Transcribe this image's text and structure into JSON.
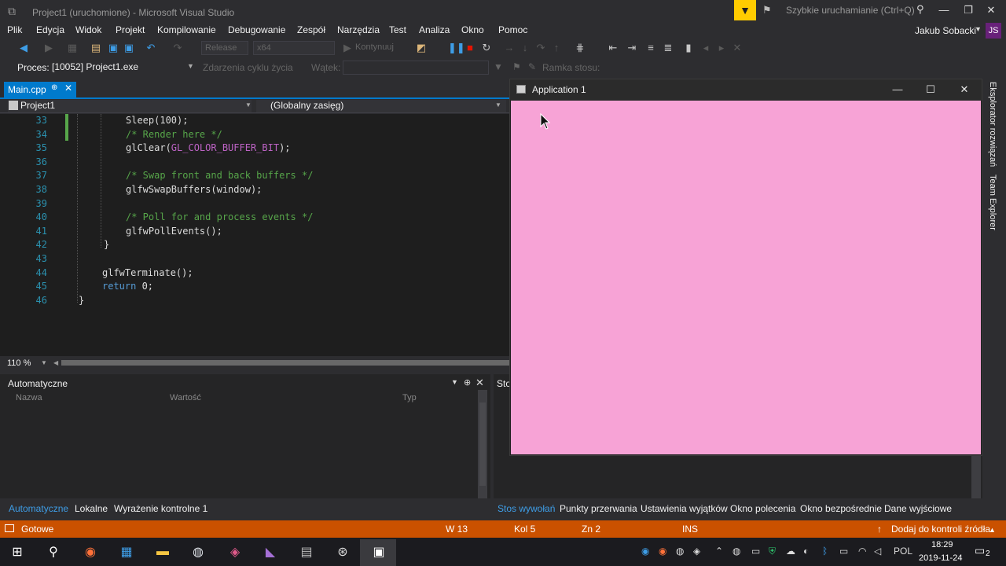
{
  "window": {
    "title": "Project1 (uruchomione) - Microsoft Visual Studio",
    "quick_launch_placeholder": "Szybkie uruchamianie (Ctrl+Q)",
    "user_name": "Jakub Sobacki",
    "user_initials": "JS"
  },
  "menu": [
    "Plik",
    "Edycja",
    "Widok",
    "Projekt",
    "Kompilowanie",
    "Debugowanie",
    "Zespół",
    "Narzędzia",
    "Test",
    "Analiza",
    "Okno",
    "Pomoc"
  ],
  "toolbar": {
    "config": "Release",
    "platform": "x64",
    "continue_label": "Kontynuuj"
  },
  "process_bar": {
    "process_label": "Proces:",
    "process_value": "[10052] Project1.exe",
    "lifecycle_label": "Zdarzenia cyklu życia",
    "thread_label": "Wątek:",
    "stack_frame_label": "Ramka stosu:"
  },
  "editor": {
    "tab_label": "Main.cpp",
    "project_combo": "Project1",
    "scope_combo": "(Globalny zasięg)",
    "zoom": "110 %",
    "lines": [
      {
        "n": "33",
        "code": "Sleep(100);"
      },
      {
        "n": "34",
        "code": "/* Render here */"
      },
      {
        "n": "35",
        "code": "glClear(",
        "macro": "GL_COLOR_BUFFER_BIT",
        "tail": ");"
      },
      {
        "n": "36",
        "code": ""
      },
      {
        "n": "37",
        "code": "/* Swap front and back buffers */"
      },
      {
        "n": "38",
        "code": "glfwSwapBuffers(window);"
      },
      {
        "n": "39",
        "code": ""
      },
      {
        "n": "40",
        "code": "/* Poll for and process events */"
      },
      {
        "n": "41",
        "code": "glfwPollEvents();"
      },
      {
        "n": "42",
        "code": "}"
      },
      {
        "n": "43",
        "code": ""
      },
      {
        "n": "44",
        "code": "glfwTerminate();"
      },
      {
        "n": "45",
        "kw": "return",
        "code": " 0;"
      },
      {
        "n": "46",
        "code": "}"
      }
    ]
  },
  "autos": {
    "title": "Automatyczne",
    "columns": [
      "Nazwa",
      "Wartość",
      "Typ"
    ],
    "tabs": [
      "Automatyczne",
      "Lokalne",
      "Wyrażenie kontrolne 1"
    ]
  },
  "callstack": {
    "peek_title": "Sto",
    "tabs": [
      "Stos wywołań",
      "Punkty przerwania",
      "Ustawienia wyjątków",
      "Okno polecenia",
      "Okno bezpośrednie",
      "Dane wyjściowe"
    ]
  },
  "side_tabs": [
    "Eksplorator rozwiązań",
    "Team Explorer"
  ],
  "app_window": {
    "title": "Application 1",
    "canvas_color": "#f7a3d6"
  },
  "status": {
    "ready": "Gotowe",
    "line": "W 13",
    "col": "Kol 5",
    "char": "Zn 2",
    "mode": "INS",
    "source_control": "Dodaj do kontroli źródła"
  },
  "taskbar": {
    "language": "POL",
    "time": "18:29",
    "date": "2019-11-24",
    "notifications": "2"
  },
  "colors": {
    "accent": "#007acc",
    "status_bar": "#ca5100",
    "filter_button": "#ffcc00"
  }
}
